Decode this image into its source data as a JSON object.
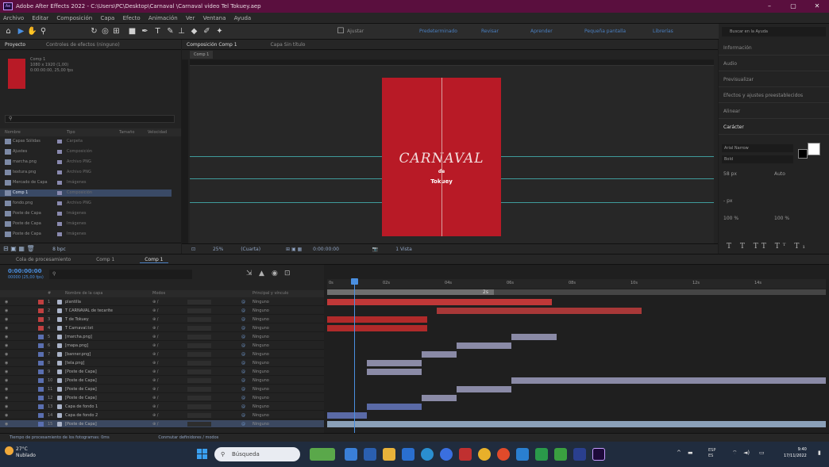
{
  "window": {
    "title": "Adobe After Effects 2022 - C:\\Users\\PC\\Desktop\\Carnaval \\Carnaval video Tel Tokuey.aep",
    "controls": [
      "–",
      "▢",
      "✕"
    ]
  },
  "menu": [
    "Archivo",
    "Editar",
    "Composición",
    "Capa",
    "Efecto",
    "Animación",
    "Ver",
    "Ventana",
    "Ayuda"
  ],
  "toolbar": {
    "workspaces": [
      "Predeterminado",
      "Revisar",
      "Aprender",
      "Pequeña pantalla",
      "Librerías"
    ],
    "help_search": "Buscar en la Ayuda",
    "snap_label": "Ajustar"
  },
  "project": {
    "tabs": [
      "Proyecto",
      "Controles de efectos (ninguno)"
    ],
    "selected_name": "Comp 1",
    "selected_meta": [
      "1080 x 1920 (1,00)",
      "0:00:00:00, 25,00 fps"
    ],
    "search_placeholder": "",
    "columns": [
      "Nombre",
      "Tipo",
      "Tamaño",
      "Velocidad"
    ],
    "items": [
      {
        "name": "Capas Sólidas",
        "type": "Carpeta"
      },
      {
        "name": "Ajustes",
        "type": "Composición"
      },
      {
        "name": "marcha.png",
        "type": "Archivo PNG"
      },
      {
        "name": "textura.png",
        "type": "Archivo PNG"
      },
      {
        "name": "Mercado de Capa",
        "type": "Imágenes"
      },
      {
        "name": "Comp 1",
        "type": "Composición",
        "selected": true
      },
      {
        "name": "fondo.png",
        "type": "Archivo PNG"
      },
      {
        "name": "Poste de Capa",
        "type": "Imágenes"
      },
      {
        "name": "Poste de Capa",
        "type": "Imágenes"
      },
      {
        "name": "Poste de Capa",
        "type": "Imágenes"
      }
    ],
    "bpc": "8 bpc"
  },
  "composition": {
    "tab": "Composición Comp 1",
    "layer_tab": "Capa Sin título",
    "subtab": "Comp 1",
    "canvas_title": "CARNAVAL",
    "canvas_de": "de",
    "canvas_place": "Tokuey",
    "canvas_color": "#b81a26",
    "zoom": "25%",
    "resolution": "(Cuarta)",
    "timecode": "0:00:00:00",
    "camera": "1 Vista"
  },
  "right_panel": {
    "sections": [
      "Información",
      "Audio",
      "Previsualizar",
      "Efectos y ajustes preestablecidos",
      "Alinear",
      "Carácter"
    ],
    "font_family": "Arial Narrow",
    "font_style": "Bold",
    "font_size": "58 px",
    "tracking": "Auto",
    "stroke": "- px",
    "scale_v": "100 %",
    "scale_h": "100 %",
    "text_format": "T T TT Tᵀ T₁"
  },
  "timeline": {
    "tabs": [
      "Cola de procesamiento",
      "Comp 1",
      "Comp 1"
    ],
    "active_tab": "Comp 1",
    "timecode": "0:00:00:00",
    "timecode_sub": "00000 (25,00 fps)",
    "search_placeholder": "",
    "columns": [
      "#",
      "Nombre de la capa",
      "Modos",
      "Principal y vínculo"
    ],
    "layers": [
      {
        "n": "1",
        "name": "plantilla",
        "label": "#c04040",
        "parent": "Ninguno"
      },
      {
        "n": "2",
        "name": "T CARNAVAL de tecarite",
        "label": "#c04040",
        "parent": "Ninguno"
      },
      {
        "n": "3",
        "name": "T de Tokuey",
        "label": "#c04040",
        "parent": "Ninguno"
      },
      {
        "n": "4",
        "name": "T Carnaval.txt",
        "label": "#c04040",
        "parent": "Ninguno"
      },
      {
        "n": "5",
        "name": "[marcha.png]",
        "label": "#5a6fb0",
        "parent": "Ninguno"
      },
      {
        "n": "6",
        "name": "[mapa.png]",
        "label": "#5a6fb0",
        "parent": "Ninguno"
      },
      {
        "n": "7",
        "name": "[banner.png]",
        "label": "#5a6fb0",
        "parent": "Ninguno"
      },
      {
        "n": "8",
        "name": "[tela.png]",
        "label": "#5a6fb0",
        "parent": "Ninguno"
      },
      {
        "n": "9",
        "name": "[Poste de Capa]",
        "label": "#5a6fb0",
        "parent": "Ninguno"
      },
      {
        "n": "10",
        "name": "[Poste de Capa]",
        "label": "#5a6fb0",
        "parent": "Ninguno"
      },
      {
        "n": "11",
        "name": "[Poste de Capa]",
        "label": "#5a6fb0",
        "parent": "Ninguno"
      },
      {
        "n": "12",
        "name": "[Poste de Capa]",
        "label": "#5a6fb0",
        "parent": "Ninguno"
      },
      {
        "n": "13",
        "name": "Capa de fondo 1",
        "label": "#5a6fb0",
        "parent": "Ninguno"
      },
      {
        "n": "14",
        "name": "Capa de fondo 2",
        "label": "#5a6fb0",
        "parent": "Ninguno"
      },
      {
        "n": "15",
        "name": "[Poste de Capa]",
        "label": "#5a6fb0",
        "parent": "Ninguno",
        "selected": true
      }
    ],
    "tick_labels": [
      "0s",
      "02s",
      "04s",
      "06s",
      "08s",
      "10s",
      "12s",
      "14s"
    ],
    "marker": "2s",
    "footer": "Tiempo de procesamiento de los fotogramas: 0ms",
    "footer_toggle": "Conmutar definidores / modos"
  },
  "taskbar": {
    "weather_temp": "27°C",
    "weather_desc": "Nublado",
    "search_placeholder": "Búsqueda",
    "lang": "ESP",
    "lang_sub": "ES",
    "time": "9:40",
    "date": "17/11/2022"
  }
}
